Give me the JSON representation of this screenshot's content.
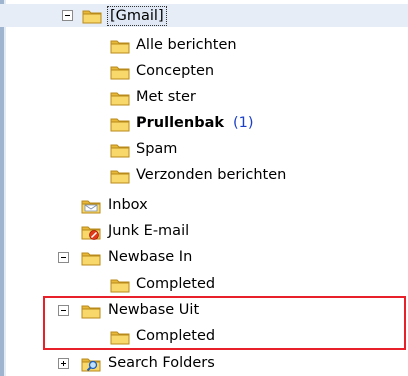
{
  "tree": {
    "gmail": {
      "label": "[Gmail]",
      "icon": "folder-icon"
    },
    "items": [
      {
        "label": "Alle berichten",
        "icon": "folder-icon"
      },
      {
        "label": "Concepten",
        "icon": "folder-icon"
      },
      {
        "label": "Met ster",
        "icon": "folder-icon"
      },
      {
        "label": "Prullenbak",
        "count": "(1)",
        "icon": "folder-icon"
      },
      {
        "label": "Spam",
        "icon": "folder-icon"
      },
      {
        "label": "Verzonden berichten",
        "icon": "folder-icon"
      }
    ],
    "inbox": {
      "label": "Inbox",
      "icon": "inbox-folder-icon"
    },
    "junk": {
      "label": "Junk E-mail",
      "icon": "junk-folder-icon"
    },
    "newbase_in": {
      "label": "Newbase In",
      "child": "Completed"
    },
    "newbase_uit": {
      "label": "Newbase Uit",
      "child": "Completed"
    },
    "search": {
      "label": "Search Folders",
      "icon": "search-folder-icon"
    }
  },
  "colors": {
    "folder": "#f2c850",
    "highlight": "#e8202a",
    "count": "#1a3fc8"
  }
}
